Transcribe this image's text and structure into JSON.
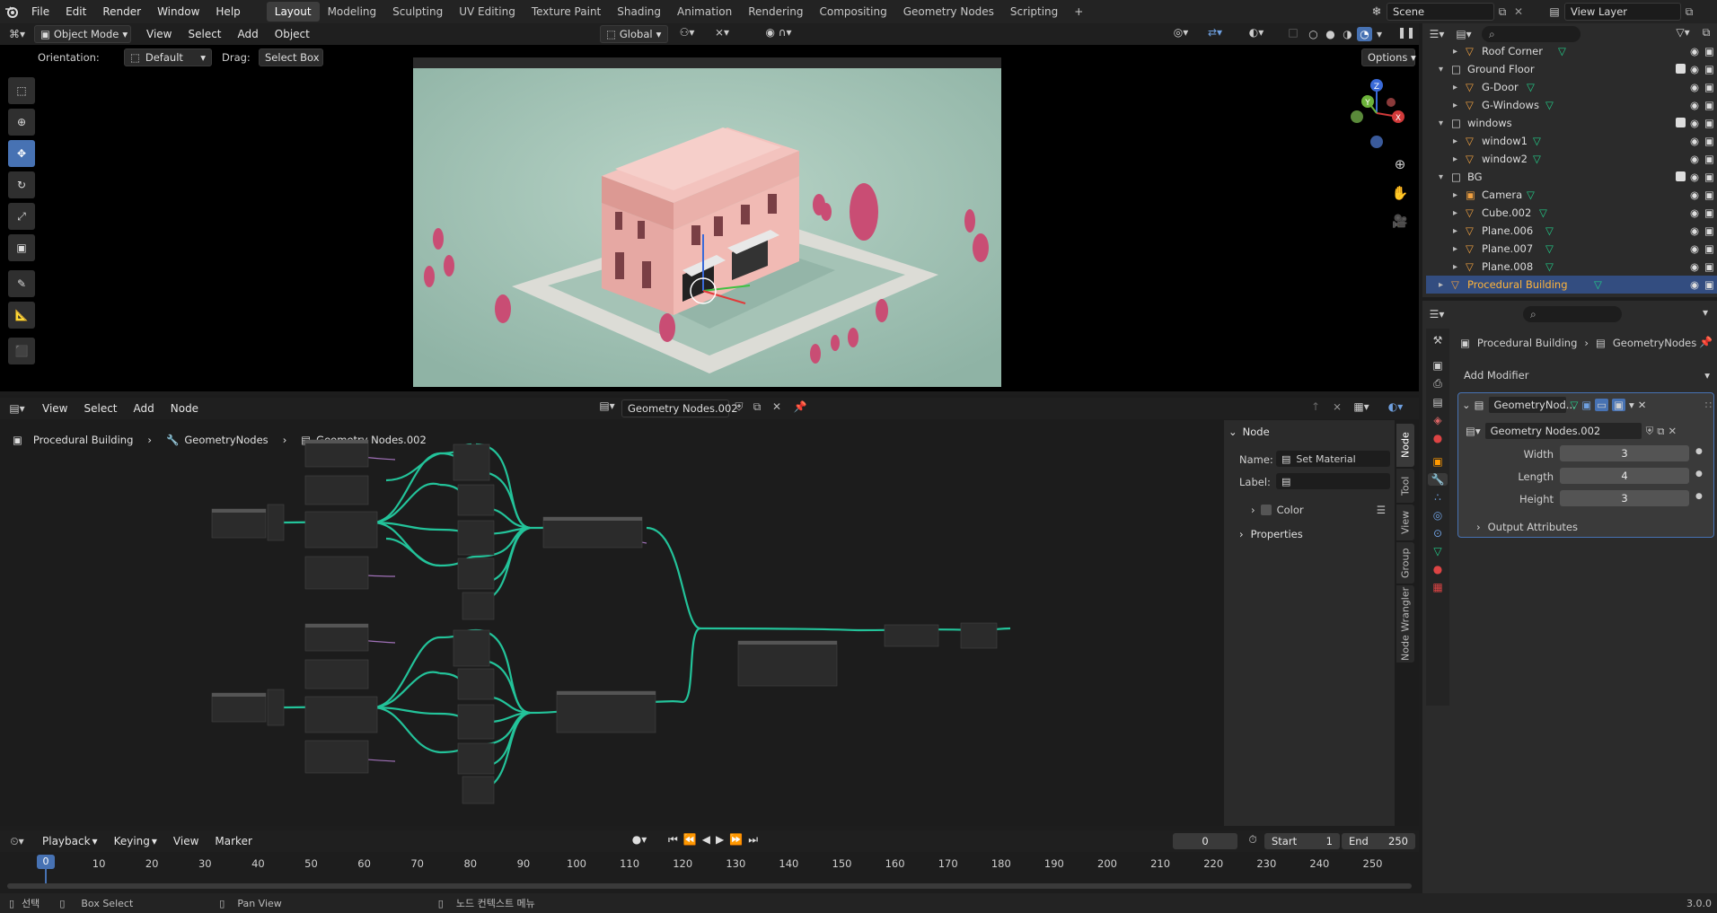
{
  "topbar": {
    "menus": [
      "File",
      "Edit",
      "Render",
      "Window",
      "Help"
    ],
    "workspaces": [
      "Layout",
      "Modeling",
      "Sculpting",
      "UV Editing",
      "Texture Paint",
      "Shading",
      "Animation",
      "Rendering",
      "Compositing",
      "Geometry Nodes",
      "Scripting"
    ],
    "active_workspace": "Layout",
    "add_tab": "+",
    "scene": "Scene",
    "view_layer": "View Layer"
  },
  "viewport": {
    "mode": "Object Mode",
    "menus": [
      "View",
      "Select",
      "Add",
      "Object"
    ],
    "transform_orientation": "Global",
    "orientation_label": "Orientation:",
    "orientation_value": "Default",
    "drag_label": "Drag:",
    "drag_value": "Select Box",
    "options": "Options",
    "gizmo": {
      "z": "Z",
      "y": "Y",
      "x": "X"
    }
  },
  "outliner": {
    "rows": [
      {
        "name": "Roof Corner",
        "kind": "mesh",
        "depth": 2
      },
      {
        "name": "Ground Floor",
        "kind": "collection",
        "depth": 1
      },
      {
        "name": "G-Door",
        "kind": "mesh",
        "depth": 2
      },
      {
        "name": "G-Windows",
        "kind": "mesh",
        "depth": 2
      },
      {
        "name": "windows",
        "kind": "collection",
        "depth": 1
      },
      {
        "name": "window1",
        "kind": "mesh",
        "depth": 2
      },
      {
        "name": "window2",
        "kind": "mesh",
        "depth": 2
      },
      {
        "name": "BG",
        "kind": "collection",
        "depth": 1
      },
      {
        "name": "Camera",
        "kind": "camera",
        "depth": 2
      },
      {
        "name": "Cube.002",
        "kind": "mesh",
        "depth": 2
      },
      {
        "name": "Plane.006",
        "kind": "mesh",
        "depth": 2
      },
      {
        "name": "Plane.007",
        "kind": "mesh",
        "depth": 2
      },
      {
        "name": "Plane.008",
        "kind": "mesh",
        "depth": 2
      },
      {
        "name": "Procedural Building",
        "kind": "mesh",
        "depth": 1,
        "selected": true
      }
    ]
  },
  "properties": {
    "breadcrumb_object": "Procedural Building",
    "breadcrumb_modifier": "GeometryNodes",
    "add_modifier": "Add Modifier",
    "modifier_name": "GeometryNod...",
    "node_group": "Geometry Nodes.002",
    "fields": [
      {
        "label": "Width",
        "value": "3"
      },
      {
        "label": "Length",
        "value": "4"
      },
      {
        "label": "Height",
        "value": "3"
      }
    ],
    "output_attributes": "Output Attributes"
  },
  "node_editor": {
    "menus": [
      "View",
      "Select",
      "Add",
      "Node"
    ],
    "node_tree": "Geometry Nodes.002",
    "breadcrumb": [
      "Procedural Building",
      "GeometryNodes",
      "Geometry Nodes.002"
    ],
    "sidebar": {
      "panel_title": "Node",
      "name_label": "Name:",
      "name_value": "Set Material",
      "label_label": "Label:",
      "label_value": "",
      "color_label": "Color",
      "properties_label": "Properties"
    },
    "tabs": [
      "Node",
      "Tool",
      "View",
      "Group",
      "Node Wrangler"
    ]
  },
  "timeline": {
    "menus": [
      "Playback",
      "Keying",
      "View",
      "Marker"
    ],
    "current_frame": "0",
    "start_label": "Start",
    "start_value": "1",
    "end_label": "End",
    "end_value": "250",
    "ticks": [
      "0",
      "10",
      "20",
      "30",
      "40",
      "50",
      "60",
      "70",
      "80",
      "90",
      "100",
      "110",
      "120",
      "130",
      "140",
      "150",
      "160",
      "170",
      "180",
      "190",
      "200",
      "210",
      "220",
      "230",
      "240",
      "250"
    ],
    "frame_marker": "0"
  },
  "statusbar": {
    "select": "선택",
    "box_select": "Box Select",
    "pan_view": "Pan View",
    "context_menu": "노드 컨텍스트 메뉴",
    "version": "3.0.0"
  },
  "colors": {
    "accent": "#4772b3",
    "wire": "#23c39a",
    "viewport_bg": "#9fbdb0",
    "building": "#e8a8a4",
    "tree": "#c94d74",
    "selected_row": "#334d80"
  }
}
